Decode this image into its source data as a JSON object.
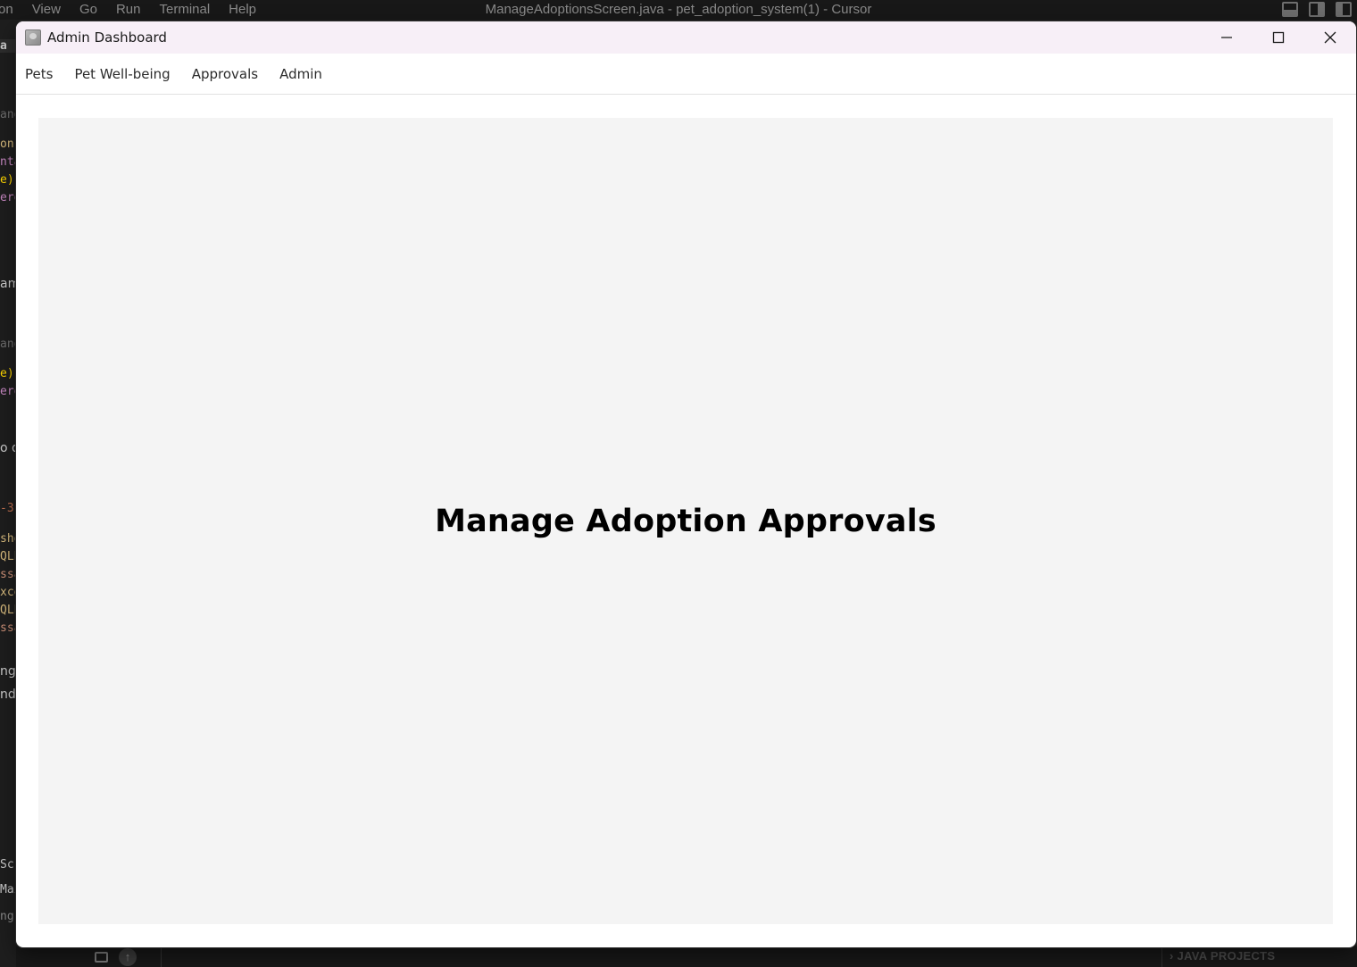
{
  "ide": {
    "menu": [
      "on",
      "View",
      "Go",
      "Run",
      "Terminal",
      "Help"
    ],
    "title": "ManageAdoptionsScreen.java - pet_adoption_system(1) - Cursor",
    "code_fragments": [
      {
        "text": "a",
        "color": "#cccccc"
      },
      {
        "text": "ang",
        "color": "#6e6e6e"
      },
      {
        "text": "on",
        "color": "#d7ba7d"
      },
      {
        "text": "nta",
        "color": "#c586c0"
      },
      {
        "text": "e)",
        "color": "#ffd700"
      },
      {
        "text": "ero",
        "color": "#c586c0"
      },
      {
        "text": "ame",
        "color": "#cccccc"
      },
      {
        "text": "ang",
        "color": "#6e6e6e"
      },
      {
        "text": "e)",
        "color": "#ffd700"
      },
      {
        "text": "ero",
        "color": "#c586c0"
      },
      {
        "text": "o d",
        "color": "#cccccc"
      },
      {
        "text": "-3",
        "color": "#c07050"
      },
      {
        "text": "sho",
        "color": "#d7ba7d"
      },
      {
        "text": "QLE",
        "color": "#d7ba7d"
      },
      {
        "text": "ssa",
        "color": "#ce9178"
      },
      {
        "text": "xce",
        "color": "#d7ba7d"
      },
      {
        "text": "QLE",
        "color": "#d7ba7d"
      },
      {
        "text": "ssa",
        "color": "#ce9178"
      },
      {
        "text": "ngl",
        "color": "#cccccc"
      },
      {
        "text": "nd",
        "color": "#cccccc"
      },
      {
        "text": "Scre",
        "color": "#cccccc"
      },
      {
        "text": "Main",
        "color": "#cccccc"
      },
      {
        "text": "ng",
        "color": "#8a8a8a"
      }
    ],
    "bottom_panel": "JAVA PROJECTS"
  },
  "window": {
    "title": "Admin Dashboard",
    "controls": [
      "minimize-icon",
      "maximize-icon",
      "close-icon"
    ],
    "menu": [
      "Pets",
      "Pet Well-being",
      "Approvals",
      "Admin"
    ],
    "heading": "Manage Adoption Approvals"
  },
  "colors": {
    "titlebar": "#f7eff7",
    "content_panel": "#f4f4f4",
    "ide_background": "#1e1e1e"
  }
}
